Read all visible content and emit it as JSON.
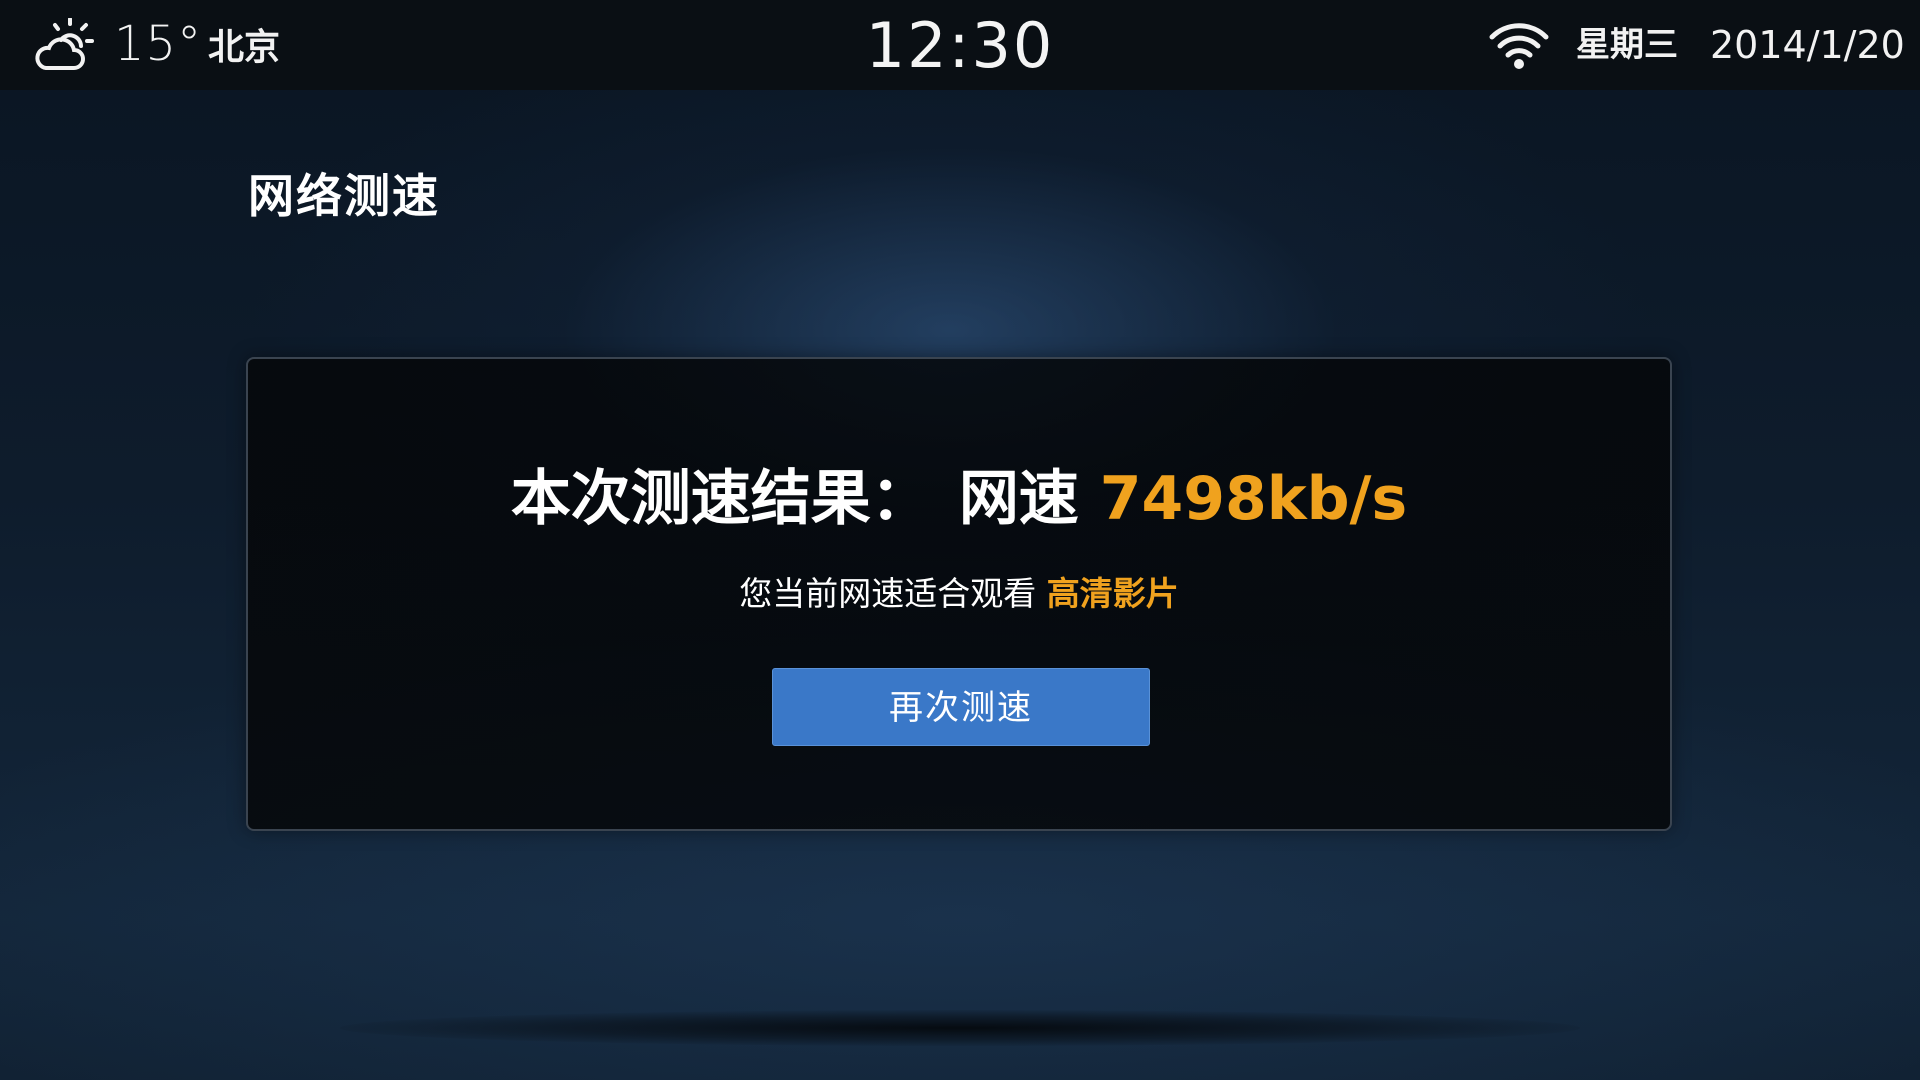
{
  "status_bar": {
    "weather_icon": "partly-cloudy-icon",
    "temperature": "15°",
    "city": "北京",
    "time": "12:30",
    "wifi_icon": "wifi-icon",
    "weekday": "星期三",
    "date": "2014/1/20"
  },
  "page": {
    "title": "网络测速"
  },
  "result": {
    "headline_prefix": "本次测速结果：",
    "speed_label": "网速",
    "speed_value": "7498kb/s",
    "suggestion_prefix": "您当前网速适合观看",
    "suggestion_quality": "高清影片",
    "retest_label": "再次测速"
  },
  "colors": {
    "accent_orange": "#f0a21e",
    "button_blue": "#3a78c8",
    "status_bar_bg": "#0a0f14"
  }
}
